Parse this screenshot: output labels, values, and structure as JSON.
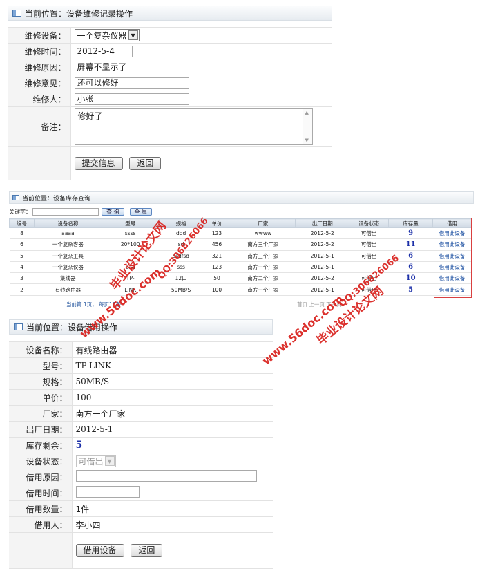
{
  "repair": {
    "breadcrumb": "当前位置：设备维修记录操作",
    "device_label": "维修设备：",
    "device_value": "一个复杂仪器",
    "time_label": "维修时间：",
    "time_value": "2012-5-4",
    "reason_label": "维修原因：",
    "reason_value": "屏幕不显示了",
    "opinion_label": "维修意见：",
    "opinion_value": "还可以修好",
    "person_label": "维修人：",
    "person_value": "小张",
    "note_label": "备注：",
    "note_value": "修好了",
    "submit_label": "提交信息",
    "back_label": "返回"
  },
  "inventory": {
    "breadcrumb": "当前位置：设备库存查询",
    "keyword_label": "关键字：",
    "query_label": "查 询",
    "all_label": "全 显",
    "columns": [
      "编号",
      "设备名称",
      "型号",
      "规格",
      "单价",
      "厂家",
      "出厂日期",
      "设备状态",
      "库存量",
      "借用"
    ],
    "rows": [
      [
        "8",
        "aaaa",
        "ssss",
        "ddd",
        "123",
        "wwww",
        "2012-5-2",
        "可借出",
        "9",
        "借用此设备"
      ],
      [
        "6",
        "一个复杂容器",
        "20*100",
        "sd",
        "456",
        "南方三个厂家",
        "2012-5-2",
        "可借出",
        "11",
        "借用此设备"
      ],
      [
        "5",
        "一个复杂工具",
        "",
        "ssdfsd",
        "321",
        "南方三个厂家",
        "2012-5-1",
        "可借出",
        "6",
        "借用此设备"
      ],
      [
        "4",
        "一个复杂仪器",
        "aaa",
        "sss",
        "123",
        "南方一个厂家",
        "2012-5-1",
        "",
        "6",
        "借用此设备"
      ],
      [
        "3",
        "集线器",
        "TP-",
        "12口",
        "50",
        "南方二个厂家",
        "2012-5-2",
        "可借出",
        "10",
        "借用此设备"
      ],
      [
        "2",
        "有线路由器",
        "LINK",
        "50MB/S",
        "100",
        "南方一个厂家",
        "2012-5-1",
        "可借出",
        "5",
        "借用此设备"
      ]
    ],
    "pager_left": "当前第 1页，     每页18条",
    "pager_right": "首页 上一页 下一页"
  },
  "borrow": {
    "breadcrumb": "当前位置：设备借用操作",
    "name_label": "设备名称：",
    "name_value": "有线路由器",
    "model_label": "型号：",
    "model_value": "TP-LINK",
    "spec_label": "规格：",
    "spec_value": "50MB/S",
    "price_label": "单价：",
    "price_value": "100",
    "maker_label": "厂家：",
    "maker_value": "南方一个厂家",
    "date_label": "出厂日期：",
    "date_value": "2012-5-1",
    "stock_label": "库存剩余：",
    "stock_value": "5",
    "status_label": "设备状态：",
    "status_value": "可借出",
    "reason_label": "借用原因：",
    "reason_value": "",
    "time_label": "借用时间：",
    "time_value": "",
    "qty_label": "借用数量：",
    "qty_value": "1件",
    "person_label": "借用人：",
    "person_value": "李小四",
    "submit_label": "借用设备",
    "back_label": "返回"
  },
  "watermark": {
    "site": "www.56doc.com",
    "qq": "QQ:306826066",
    "slogan": "毕业设计论文网"
  },
  "colors": {
    "watermark": "#d9201c",
    "stock_number": "#1b2fa8",
    "link": "#1a4ea0",
    "borrow_frame": "#d94040"
  }
}
